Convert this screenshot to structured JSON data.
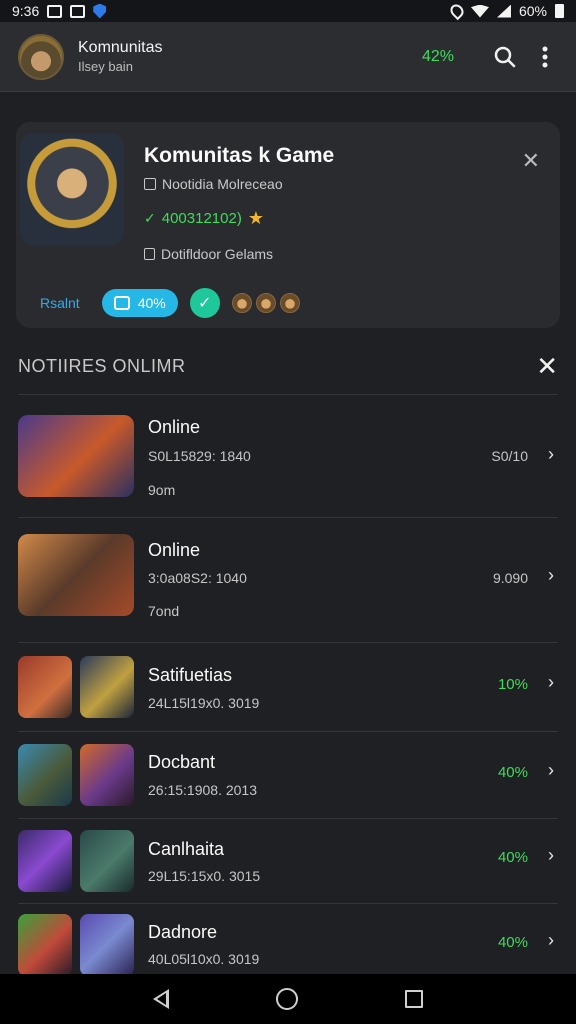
{
  "status_bar": {
    "time": "9:36",
    "battery": "60%",
    "icons": [
      "screen-icon",
      "message-icon",
      "shield-icon",
      "location-icon",
      "wifi-icon",
      "signal-icon",
      "battery-icon"
    ]
  },
  "app_bar": {
    "title": "Komnunitas",
    "subtitle": "Ilsey bain",
    "percent": "42%",
    "icons": [
      "search-icon",
      "more-icon"
    ]
  },
  "community_card": {
    "title": "Komunitas k Game",
    "line1": "Nootidia Molreceao",
    "line2": "400312102)",
    "line3": "Dotifldoor Gelams",
    "link": "Rsalnt",
    "pill_label": "40%",
    "close_icon": "close-icon"
  },
  "section": {
    "title": "NOTIIRES ONLIMR"
  },
  "items": [
    {
      "title": "Online",
      "sub": "S0L15829: 1840",
      "sub2": "9om",
      "value": "S0/10",
      "green": false
    },
    {
      "title": "Online",
      "sub": "3:0a08S2: 1040",
      "sub2": "7ond",
      "value": "9.090",
      "green": false
    },
    {
      "title": "Satifuetias",
      "sub": "24L15l19x0. 3019",
      "value": "10%",
      "green": true
    },
    {
      "title": "Docbant",
      "sub": "26:15:1908. 2013",
      "value": "40%",
      "green": true
    },
    {
      "title": "Canlhaita",
      "sub": "29L15:15x0. 3015",
      "value": "40%",
      "green": true
    },
    {
      "title": "Dadnore",
      "sub": "40L05l10x0. 3019",
      "value": "40%",
      "green": true
    }
  ],
  "colors": {
    "accent_green": "#3ddc5a",
    "pill_blue": "#25b7e6",
    "link_blue": "#36a9e8",
    "background": "#1f2023",
    "card": "#2a2b2f"
  }
}
